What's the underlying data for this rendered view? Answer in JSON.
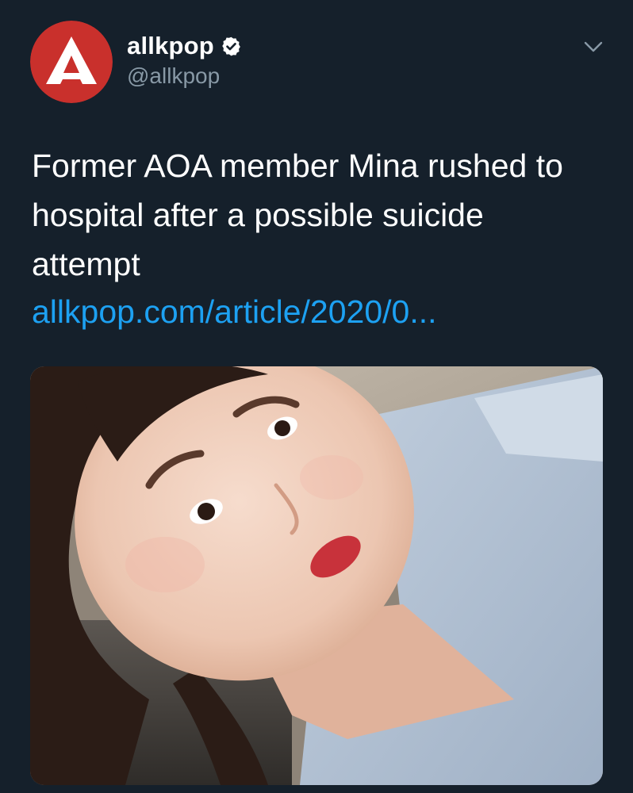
{
  "author": {
    "name": "allkpop",
    "handle": "@allkpop",
    "avatar_icon": "allkpop-logo-icon",
    "verified_icon": "verified-badge-icon"
  },
  "menu_icon": "chevron-down-icon",
  "tweet": {
    "text_lines": [
      "Former AOA member Mina rushed to",
      "hospital after a possible suicide",
      "attempt"
    ],
    "link": "allkpop.com/article/2020/0..."
  },
  "colors": {
    "background": "#15202b",
    "text": "#ffffff",
    "secondary_text": "#8899a6",
    "link": "#1da1f2",
    "brand_red": "#c9302c"
  }
}
